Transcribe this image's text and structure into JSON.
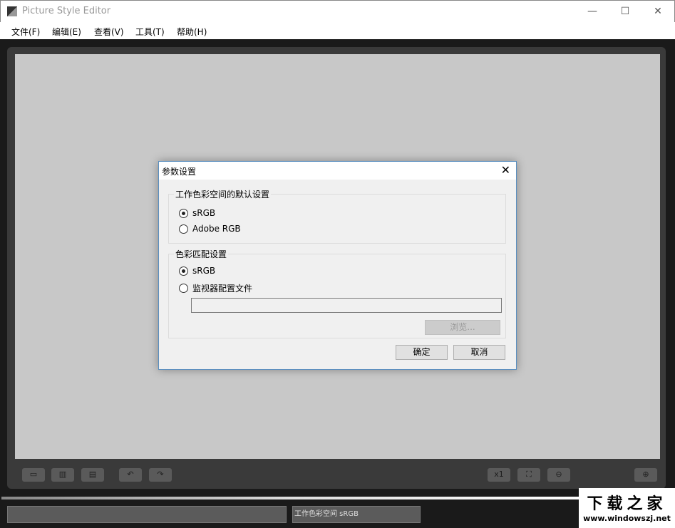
{
  "window": {
    "title": "Picture Style Editor",
    "minimize": "—",
    "maximize": "☐",
    "close": "✕"
  },
  "menu": [
    "文件(F)",
    "编辑(E)",
    "查看(V)",
    "工具(T)",
    "帮助(H)"
  ],
  "toolbar": {
    "single_view": "▭",
    "side_by_side": "▥",
    "top_bottom": "▤",
    "rotate_left": "↶",
    "rotate_right": "↷",
    "zoom_1x": "x1",
    "fit": "⛶",
    "zoom_out": "⊖",
    "zoom_in": "⊕"
  },
  "status": {
    "left": "",
    "color_space": "工作色彩空间 sRGB"
  },
  "watermark": {
    "title": "下载之家",
    "url": "www.windowszj.net"
  },
  "dialog": {
    "title": "参数设置",
    "close": "✕",
    "group1": {
      "label": "工作色彩空间的默认设置",
      "options": [
        {
          "label": "sRGB",
          "checked": true
        },
        {
          "label": "Adobe RGB",
          "checked": false
        }
      ]
    },
    "group2": {
      "label": "色彩匹配设置",
      "options": [
        {
          "label": "sRGB",
          "checked": true
        },
        {
          "label": "监视器配置文件",
          "checked": false
        }
      ],
      "file_value": "",
      "browse": "浏览..."
    },
    "ok": "确定",
    "cancel": "取消"
  }
}
